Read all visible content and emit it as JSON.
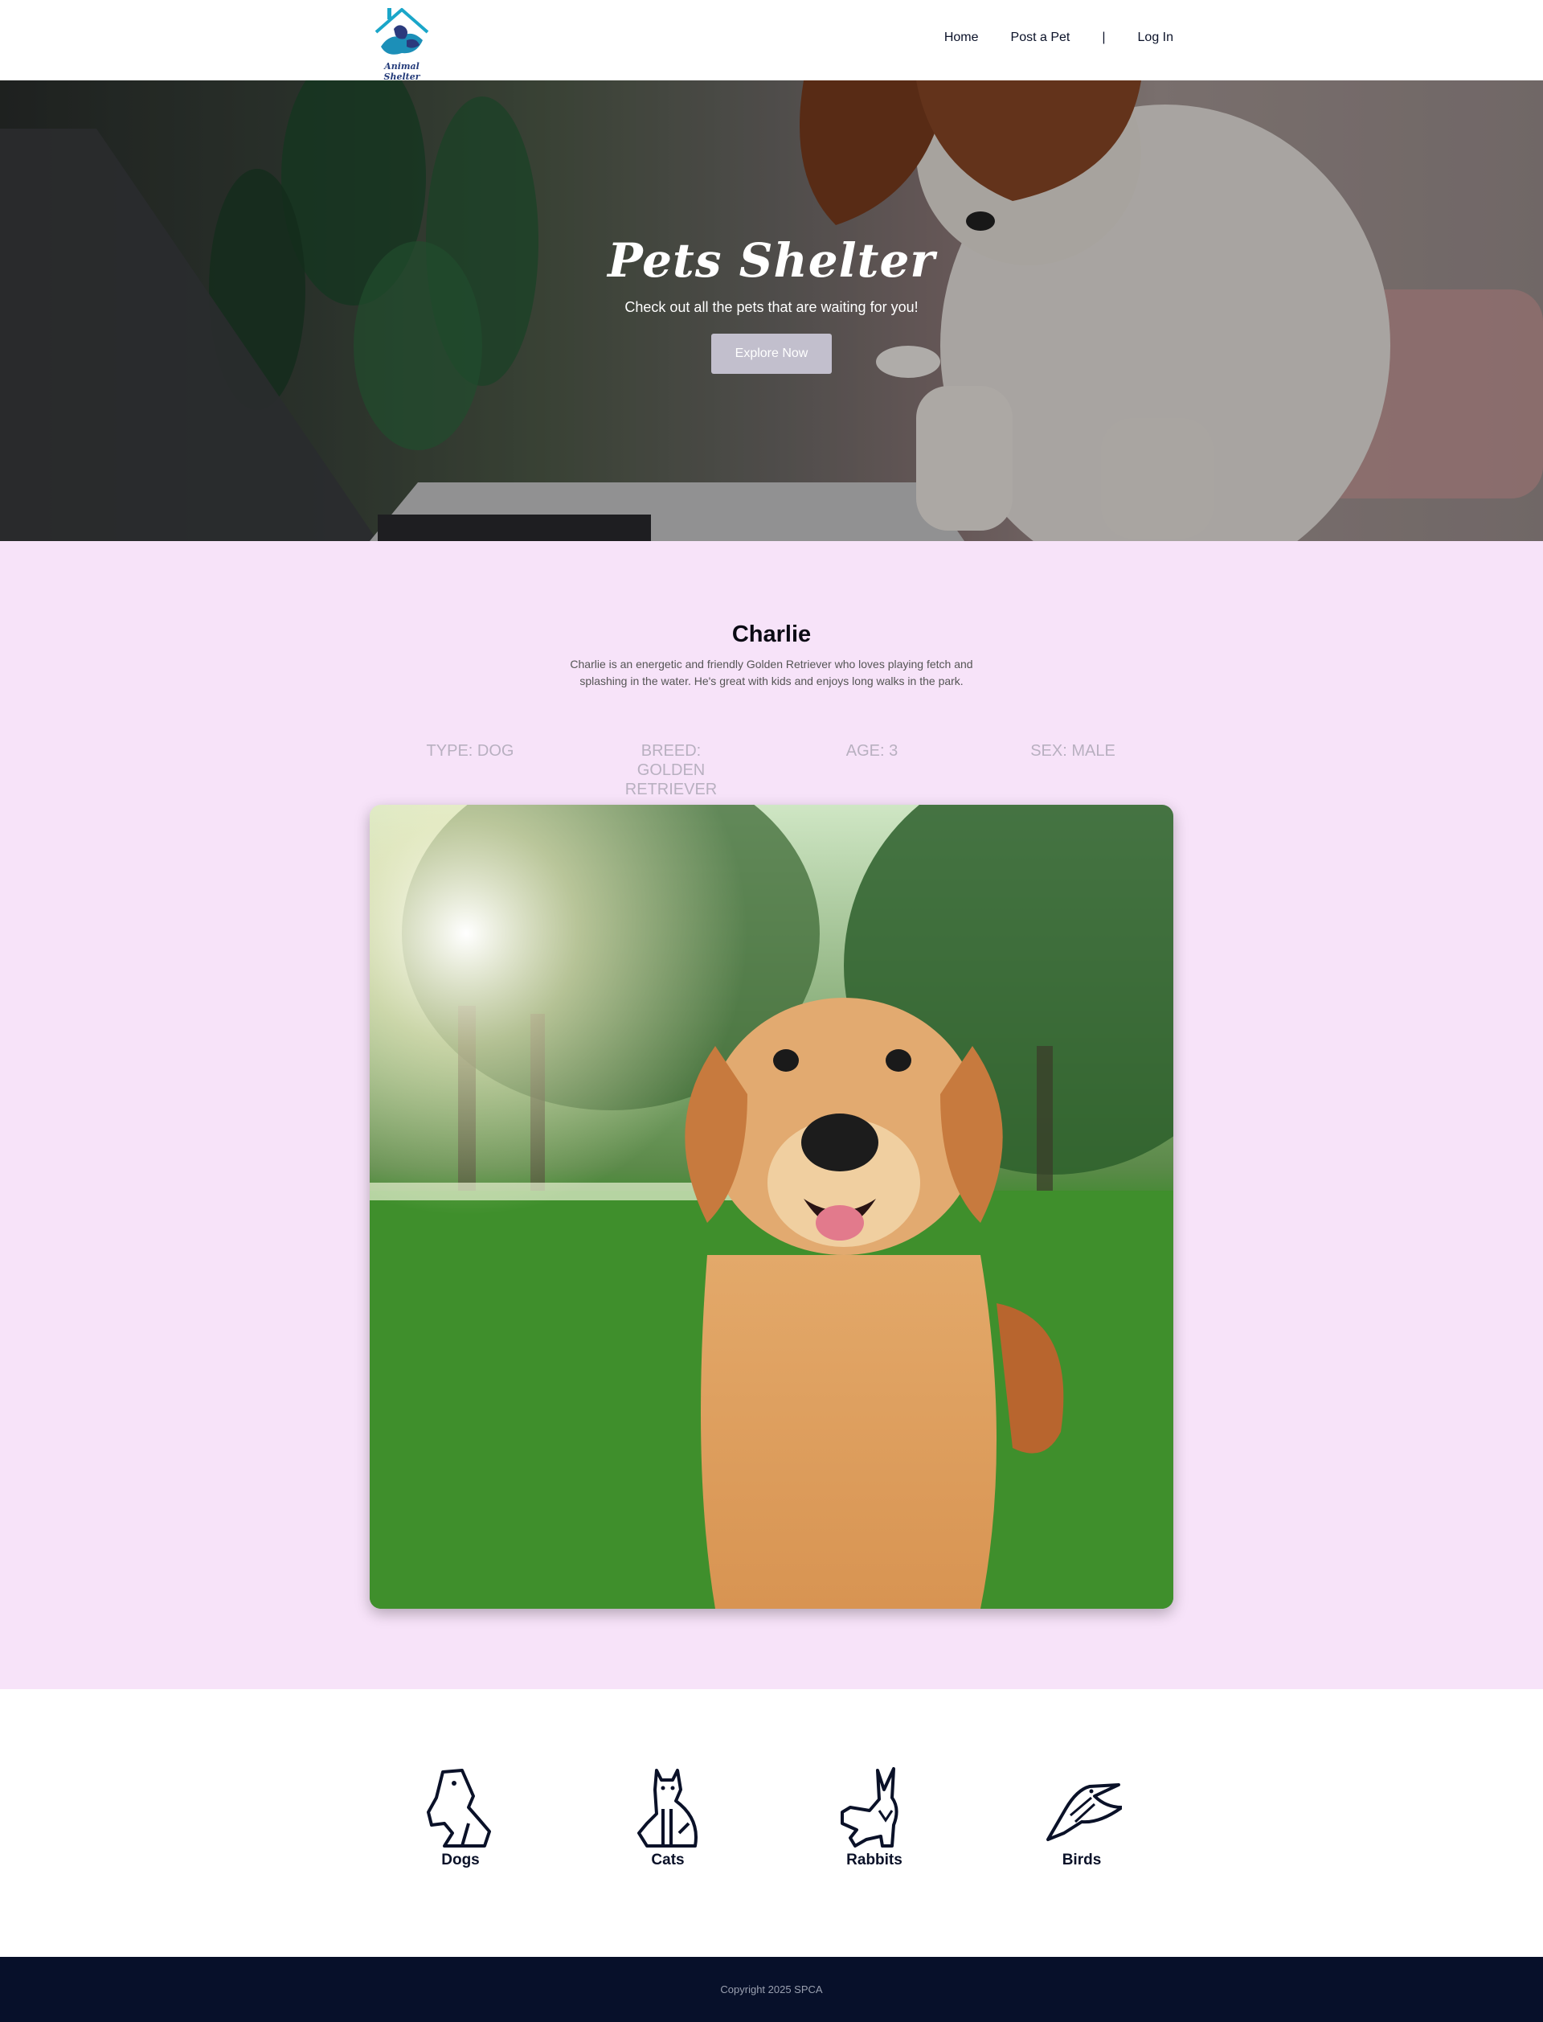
{
  "header": {
    "logo_text": "Animal Shelter",
    "nav": {
      "home": "Home",
      "post_pet": "Post a Pet",
      "separator": "|",
      "login": "Log In"
    }
  },
  "hero": {
    "title": "Pets Shelter",
    "subtitle": "Check out all the pets that are waiting for you!",
    "button": "Explore Now"
  },
  "pet": {
    "name": "Charlie",
    "description": "Charlie is an energetic and friendly Golden Retriever who loves playing fetch and splashing in the water. He's great with kids and enjoys long walks in the park.",
    "stats": {
      "type": "Type: Dog",
      "breed": "Breed: Golden Retriever",
      "age": "Age: 3",
      "sex": "Sex: Male"
    }
  },
  "categories": [
    {
      "label": "Dogs",
      "icon": "dog-icon"
    },
    {
      "label": "Cats",
      "icon": "cat-icon"
    },
    {
      "label": "Rabbits",
      "icon": "rabbit-icon"
    },
    {
      "label": "Birds",
      "icon": "bird-icon"
    }
  ],
  "footer": {
    "copyright": "Copyright 2025 SPCA"
  },
  "colors": {
    "pet_section_bg": "#f7e3f9",
    "footer_bg": "#07102a",
    "hero_button": "#c2bfcd",
    "stat_text": "#b8b0c0"
  }
}
